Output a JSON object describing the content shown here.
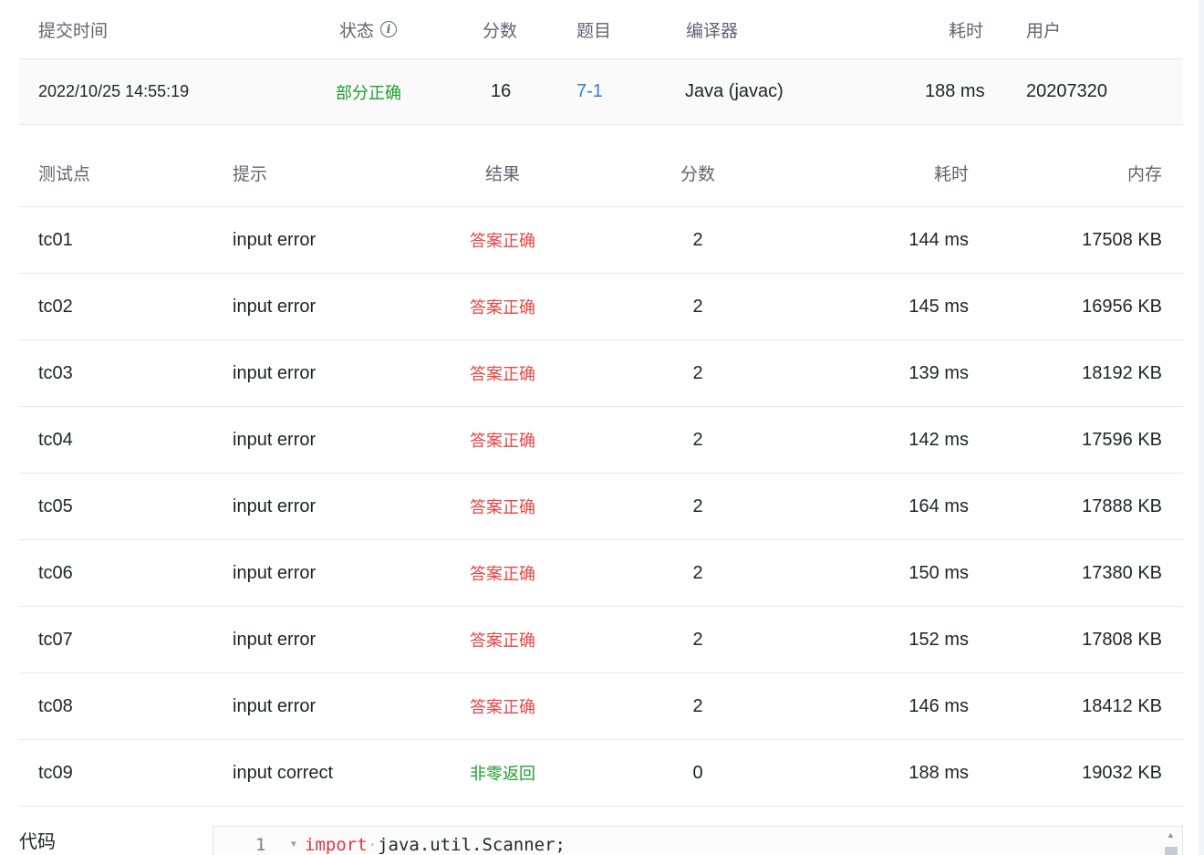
{
  "submission": {
    "headers": {
      "time": "提交时间",
      "status": "状态",
      "score": "分数",
      "problem": "题目",
      "compiler": "编译器",
      "elapsed": "耗时",
      "user": "用户"
    },
    "row": {
      "time": "2022/10/25 14:55:19",
      "status": "部分正确",
      "score": "16",
      "problem": "7-1",
      "compiler": "Java (javac)",
      "elapsed": "188 ms",
      "user": "20207320"
    }
  },
  "testcases": {
    "headers": {
      "point": "测试点",
      "hint": "提示",
      "result": "结果",
      "score": "分数",
      "elapsed": "耗时",
      "memory": "内存"
    },
    "rows": [
      {
        "point": "tc01",
        "hint": "input error",
        "result": "答案正确",
        "score": "2",
        "elapsed": "144 ms",
        "memory": "17508 KB",
        "status": "accepted"
      },
      {
        "point": "tc02",
        "hint": "input error",
        "result": "答案正确",
        "score": "2",
        "elapsed": "145 ms",
        "memory": "16956 KB",
        "status": "accepted"
      },
      {
        "point": "tc03",
        "hint": "input error",
        "result": "答案正确",
        "score": "2",
        "elapsed": "139 ms",
        "memory": "18192 KB",
        "status": "accepted"
      },
      {
        "point": "tc04",
        "hint": "input error",
        "result": "答案正确",
        "score": "2",
        "elapsed": "142 ms",
        "memory": "17596 KB",
        "status": "accepted"
      },
      {
        "point": "tc05",
        "hint": "input error",
        "result": "答案正确",
        "score": "2",
        "elapsed": "164 ms",
        "memory": "17888 KB",
        "status": "accepted"
      },
      {
        "point": "tc06",
        "hint": "input error",
        "result": "答案正确",
        "score": "2",
        "elapsed": "150 ms",
        "memory": "17380 KB",
        "status": "accepted"
      },
      {
        "point": "tc07",
        "hint": "input error",
        "result": "答案正确",
        "score": "2",
        "elapsed": "152 ms",
        "memory": "17808 KB",
        "status": "accepted"
      },
      {
        "point": "tc08",
        "hint": "input error",
        "result": "答案正确",
        "score": "2",
        "elapsed": "146 ms",
        "memory": "18412 KB",
        "status": "accepted"
      },
      {
        "point": "tc09",
        "hint": "input correct",
        "result": "非零返回",
        "score": "0",
        "elapsed": "188 ms",
        "memory": "19032 KB",
        "status": "nonzero"
      }
    ]
  },
  "code": {
    "label": "代码",
    "line_number": "1",
    "keyword": "import",
    "rest": "java.util.Scanner;"
  },
  "colors": {
    "accepted_text": "#e54545",
    "nonzero_text": "#1e9e2f",
    "partial_status": "#1e9e2f",
    "link": "#2f7fdb"
  },
  "icons": {
    "status_info": "info-circle-icon",
    "fold": "fold-arrow-icon",
    "scroll_up": "scroll-up-arrow-icon"
  }
}
